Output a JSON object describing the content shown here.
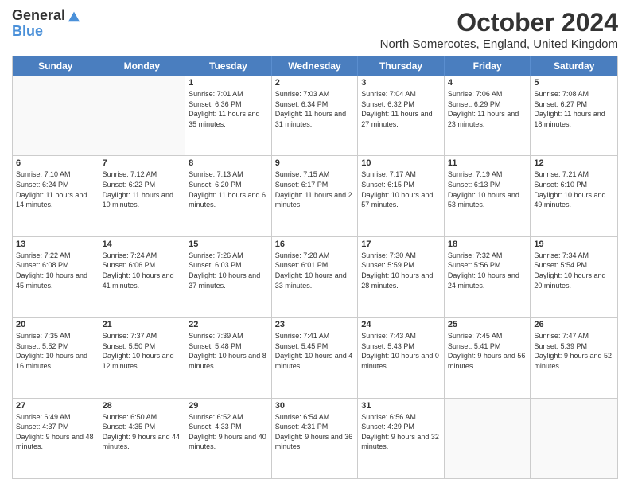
{
  "logo": {
    "line1": "General",
    "line2": "Blue"
  },
  "title": "October 2024",
  "subtitle": "North Somercotes, England, United Kingdom",
  "days_of_week": [
    "Sunday",
    "Monday",
    "Tuesday",
    "Wednesday",
    "Thursday",
    "Friday",
    "Saturday"
  ],
  "weeks": [
    [
      {
        "day": "",
        "info": ""
      },
      {
        "day": "",
        "info": ""
      },
      {
        "day": "1",
        "info": "Sunrise: 7:01 AM\nSunset: 6:36 PM\nDaylight: 11 hours and 35 minutes."
      },
      {
        "day": "2",
        "info": "Sunrise: 7:03 AM\nSunset: 6:34 PM\nDaylight: 11 hours and 31 minutes."
      },
      {
        "day": "3",
        "info": "Sunrise: 7:04 AM\nSunset: 6:32 PM\nDaylight: 11 hours and 27 minutes."
      },
      {
        "day": "4",
        "info": "Sunrise: 7:06 AM\nSunset: 6:29 PM\nDaylight: 11 hours and 23 minutes."
      },
      {
        "day": "5",
        "info": "Sunrise: 7:08 AM\nSunset: 6:27 PM\nDaylight: 11 hours and 18 minutes."
      }
    ],
    [
      {
        "day": "6",
        "info": "Sunrise: 7:10 AM\nSunset: 6:24 PM\nDaylight: 11 hours and 14 minutes."
      },
      {
        "day": "7",
        "info": "Sunrise: 7:12 AM\nSunset: 6:22 PM\nDaylight: 11 hours and 10 minutes."
      },
      {
        "day": "8",
        "info": "Sunrise: 7:13 AM\nSunset: 6:20 PM\nDaylight: 11 hours and 6 minutes."
      },
      {
        "day": "9",
        "info": "Sunrise: 7:15 AM\nSunset: 6:17 PM\nDaylight: 11 hours and 2 minutes."
      },
      {
        "day": "10",
        "info": "Sunrise: 7:17 AM\nSunset: 6:15 PM\nDaylight: 10 hours and 57 minutes."
      },
      {
        "day": "11",
        "info": "Sunrise: 7:19 AM\nSunset: 6:13 PM\nDaylight: 10 hours and 53 minutes."
      },
      {
        "day": "12",
        "info": "Sunrise: 7:21 AM\nSunset: 6:10 PM\nDaylight: 10 hours and 49 minutes."
      }
    ],
    [
      {
        "day": "13",
        "info": "Sunrise: 7:22 AM\nSunset: 6:08 PM\nDaylight: 10 hours and 45 minutes."
      },
      {
        "day": "14",
        "info": "Sunrise: 7:24 AM\nSunset: 6:06 PM\nDaylight: 10 hours and 41 minutes."
      },
      {
        "day": "15",
        "info": "Sunrise: 7:26 AM\nSunset: 6:03 PM\nDaylight: 10 hours and 37 minutes."
      },
      {
        "day": "16",
        "info": "Sunrise: 7:28 AM\nSunset: 6:01 PM\nDaylight: 10 hours and 33 minutes."
      },
      {
        "day": "17",
        "info": "Sunrise: 7:30 AM\nSunset: 5:59 PM\nDaylight: 10 hours and 28 minutes."
      },
      {
        "day": "18",
        "info": "Sunrise: 7:32 AM\nSunset: 5:56 PM\nDaylight: 10 hours and 24 minutes."
      },
      {
        "day": "19",
        "info": "Sunrise: 7:34 AM\nSunset: 5:54 PM\nDaylight: 10 hours and 20 minutes."
      }
    ],
    [
      {
        "day": "20",
        "info": "Sunrise: 7:35 AM\nSunset: 5:52 PM\nDaylight: 10 hours and 16 minutes."
      },
      {
        "day": "21",
        "info": "Sunrise: 7:37 AM\nSunset: 5:50 PM\nDaylight: 10 hours and 12 minutes."
      },
      {
        "day": "22",
        "info": "Sunrise: 7:39 AM\nSunset: 5:48 PM\nDaylight: 10 hours and 8 minutes."
      },
      {
        "day": "23",
        "info": "Sunrise: 7:41 AM\nSunset: 5:45 PM\nDaylight: 10 hours and 4 minutes."
      },
      {
        "day": "24",
        "info": "Sunrise: 7:43 AM\nSunset: 5:43 PM\nDaylight: 10 hours and 0 minutes."
      },
      {
        "day": "25",
        "info": "Sunrise: 7:45 AM\nSunset: 5:41 PM\nDaylight: 9 hours and 56 minutes."
      },
      {
        "day": "26",
        "info": "Sunrise: 7:47 AM\nSunset: 5:39 PM\nDaylight: 9 hours and 52 minutes."
      }
    ],
    [
      {
        "day": "27",
        "info": "Sunrise: 6:49 AM\nSunset: 4:37 PM\nDaylight: 9 hours and 48 minutes."
      },
      {
        "day": "28",
        "info": "Sunrise: 6:50 AM\nSunset: 4:35 PM\nDaylight: 9 hours and 44 minutes."
      },
      {
        "day": "29",
        "info": "Sunrise: 6:52 AM\nSunset: 4:33 PM\nDaylight: 9 hours and 40 minutes."
      },
      {
        "day": "30",
        "info": "Sunrise: 6:54 AM\nSunset: 4:31 PM\nDaylight: 9 hours and 36 minutes."
      },
      {
        "day": "31",
        "info": "Sunrise: 6:56 AM\nSunset: 4:29 PM\nDaylight: 9 hours and 32 minutes."
      },
      {
        "day": "",
        "info": ""
      },
      {
        "day": "",
        "info": ""
      }
    ]
  ]
}
